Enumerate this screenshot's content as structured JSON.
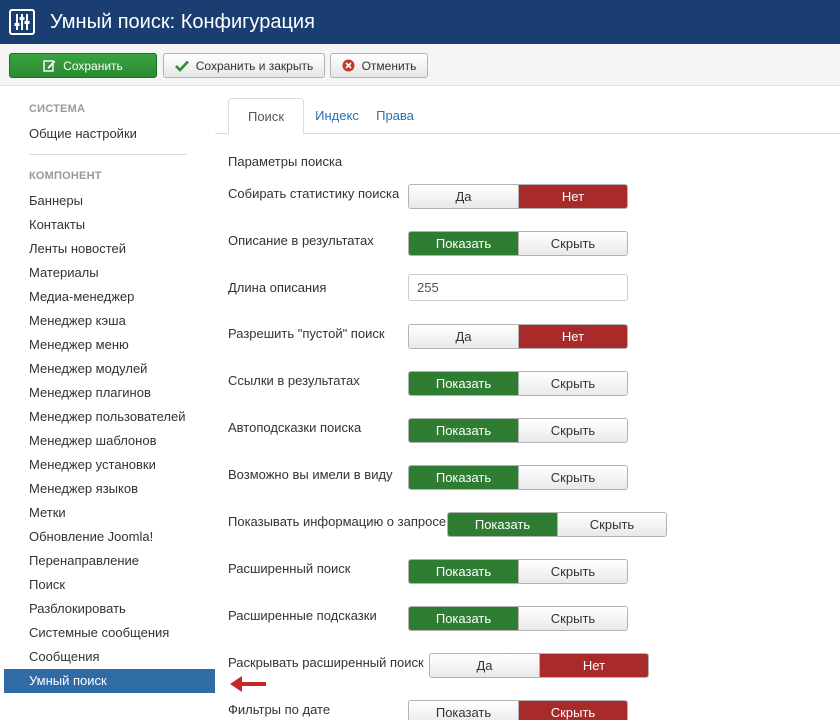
{
  "header": {
    "title": "Умный поиск: Конфигурация",
    "icon": "sliders-icon",
    "bg": "#1b3e72"
  },
  "toolbar": {
    "save_label": "Сохранить",
    "save_close_label": "Сохранить и закрыть",
    "cancel_label": "Отменить"
  },
  "sidebar": {
    "section_system": "СИСТЕМА",
    "general_settings": "Общие настройки",
    "section_component": "КОМПОНЕНТ",
    "items": [
      "Баннеры",
      "Контакты",
      "Ленты новостей",
      "Материалы",
      "Медиа-менеджер",
      "Менеджер кэша",
      "Менеджер меню",
      "Менеджер модулей",
      "Менеджер плагинов",
      "Менеджер пользователей",
      "Менеджер шаблонов",
      "Менеджер установки",
      "Менеджер языков",
      "Метки",
      "Обновление Joomla!",
      "Перенаправление",
      "Поиск",
      "Разблокировать",
      "Системные сообщения",
      "Сообщения",
      "Умный поиск"
    ],
    "active_item": "Умный поиск"
  },
  "tabs": [
    "Поиск",
    "Индекс",
    "Права"
  ],
  "active_tab": "Поиск",
  "form": {
    "section_title": "Параметры поиска",
    "fields": [
      {
        "label": "Собирать статистику поиска",
        "type": "toggle",
        "options": [
          "Да",
          "Нет"
        ],
        "selected": "Нет"
      },
      {
        "label": "Описание в результатах",
        "type": "toggle",
        "options": [
          "Показать",
          "Скрыть"
        ],
        "selected": "Показать"
      },
      {
        "label": "Длина описания",
        "type": "text",
        "value": "255"
      },
      {
        "label": "Разрешить \"пустой\" поиск",
        "type": "toggle",
        "options": [
          "Да",
          "Нет"
        ],
        "selected": "Нет"
      },
      {
        "label": "Ссылки в результатах",
        "type": "toggle",
        "options": [
          "Показать",
          "Скрыть"
        ],
        "selected": "Показать"
      },
      {
        "label": "Автоподсказки поиска",
        "type": "toggle",
        "options": [
          "Показать",
          "Скрыть"
        ],
        "selected": "Показать"
      },
      {
        "label": "Возможно вы имели в виду",
        "type": "toggle",
        "options": [
          "Показать",
          "Скрыть"
        ],
        "selected": "Показать"
      },
      {
        "label": "Показывать информацию о запросе",
        "type": "toggle",
        "options": [
          "Показать",
          "Скрыть"
        ],
        "selected": "Показать"
      },
      {
        "label": "Расширенный поиск",
        "type": "toggle",
        "options": [
          "Показать",
          "Скрыть"
        ],
        "selected": "Показать"
      },
      {
        "label": "Расширенные подсказки",
        "type": "toggle",
        "options": [
          "Показать",
          "Скрыть"
        ],
        "selected": "Показать"
      },
      {
        "label": "Раскрывать расширенный поиск",
        "type": "toggle",
        "options": [
          "Да",
          "Нет"
        ],
        "selected": "Нет"
      },
      {
        "label": "Фильтры по дате",
        "type": "toggle",
        "options": [
          "Показать",
          "Скрыть"
        ],
        "selected": "Скрыть"
      }
    ]
  },
  "colors": {
    "green": "#2e7d32",
    "red": "#a82a2a",
    "accent": "#2f6ca6",
    "arrow": "#c62828"
  }
}
